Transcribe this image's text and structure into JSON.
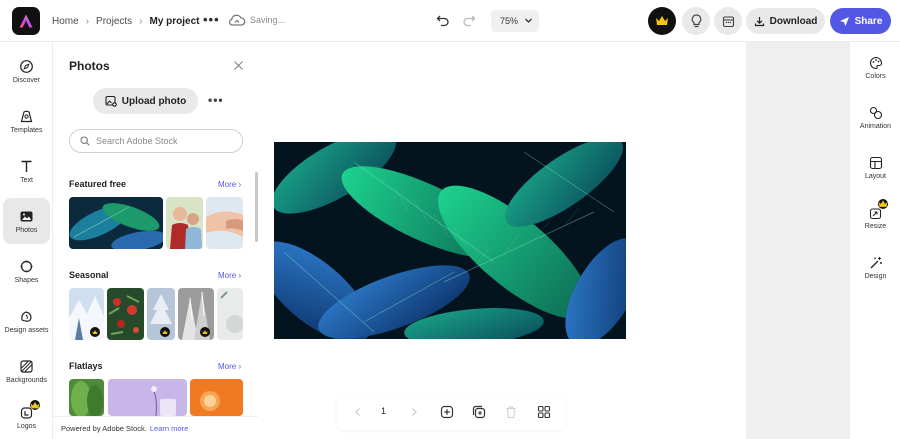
{
  "topbar": {
    "breadcrumb": [
      "Home",
      "Projects",
      "My project"
    ],
    "status": "Saving...",
    "zoom": "75%",
    "download_label": "Download",
    "share_label": "Share"
  },
  "left_rail": {
    "items": [
      {
        "label": "Discover",
        "icon": "discover-icon"
      },
      {
        "label": "Templates",
        "icon": "templates-icon"
      },
      {
        "label": "Text",
        "icon": "text-icon"
      },
      {
        "label": "Photos",
        "icon": "photos-icon",
        "active": true
      },
      {
        "label": "Shapes",
        "icon": "shapes-icon"
      },
      {
        "label": "Design assets",
        "icon": "design-assets-icon"
      },
      {
        "label": "Backgrounds",
        "icon": "backgrounds-icon"
      },
      {
        "label": "Logos",
        "icon": "logos-icon"
      }
    ]
  },
  "panel": {
    "title": "Photos",
    "upload_label": "Upload photo",
    "search_placeholder": "Search Adobe Stock",
    "sections": [
      {
        "title": "Featured free",
        "more": "More"
      },
      {
        "title": "Seasonal",
        "more": "More"
      },
      {
        "title": "Flatlays",
        "more": "More"
      }
    ],
    "footer_text": "Powered by Adobe Stock.",
    "footer_link": "Learn more"
  },
  "bottom_toolbar": {
    "page_number": "1"
  },
  "right_rail": {
    "items": [
      {
        "label": "Colors",
        "icon": "colors-icon"
      },
      {
        "label": "Animation",
        "icon": "animation-icon"
      },
      {
        "label": "Layout",
        "icon": "layout-icon"
      },
      {
        "label": "Resize",
        "icon": "resize-icon"
      },
      {
        "label": "Design",
        "icon": "design-icon"
      }
    ]
  },
  "colors": {
    "accent": "#5258e4",
    "premium_badge": "#111111"
  }
}
